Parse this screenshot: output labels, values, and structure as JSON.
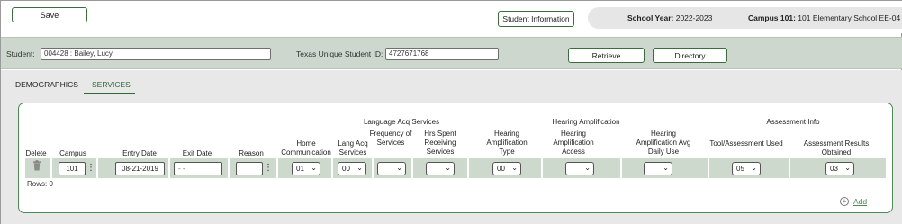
{
  "toolbar": {
    "save_label": "Save",
    "student_info_label": "Student Information"
  },
  "school": {
    "year_label": "School Year:",
    "year_value": "2022-2023",
    "campus_label": "Campus 101:",
    "campus_value": "101 Elementary School EE-04"
  },
  "student_bar": {
    "student_label": "Student:",
    "student_value": "004428 : Bailey, Lucy",
    "tsid_label": "Texas Unique Student ID:",
    "tsid_value": "4727671768",
    "retrieve_label": "Retrieve",
    "directory_label": "Directory"
  },
  "tabs": [
    {
      "label": "DEMOGRAPHICS"
    },
    {
      "label": "SERVICES"
    }
  ],
  "groups": {
    "language_acq": "Language Acq Services",
    "hearing_amp": "Hearing Amplification",
    "assessment": "Assessment Info"
  },
  "columns": {
    "delete": "Delete",
    "campus": "Campus",
    "entry_date": "Entry Date",
    "exit_date": "Exit Date",
    "reason": "Reason",
    "home_comm": "Home Communication",
    "lang_acq": "Lang Acq Services",
    "freq": "Frequency of Services",
    "hrs": "Hrs Spent Receiving Services",
    "amp_type": "Hearing Amplification Type",
    "amp_access": "Hearing Amplification Access",
    "amp_daily": "Hearing Amplification Avg Daily Use",
    "tool": "Tool/Assessment Used",
    "results": "Assessment Results Obtained"
  },
  "row": {
    "campus": "101",
    "entry_date": "08-21-2019",
    "exit_date": " - -",
    "reason": "",
    "home_comm": "01",
    "lang_acq": "00",
    "freq": "",
    "hrs": "",
    "amp_type": "00",
    "amp_access": "",
    "amp_daily": "",
    "tool": "05",
    "results": "03"
  },
  "rows_label": "Rows: 0",
  "add_label": "Add",
  "icons": {
    "trash": "trash-icon",
    "kebab": "kebab-menu-icon",
    "chevron": "chevron-down-icon",
    "add": "plus-circle-icon"
  },
  "colors": {
    "accent": "#4f8a55",
    "band": "#cdd9cd",
    "student_bar": "#cdd7cd"
  }
}
